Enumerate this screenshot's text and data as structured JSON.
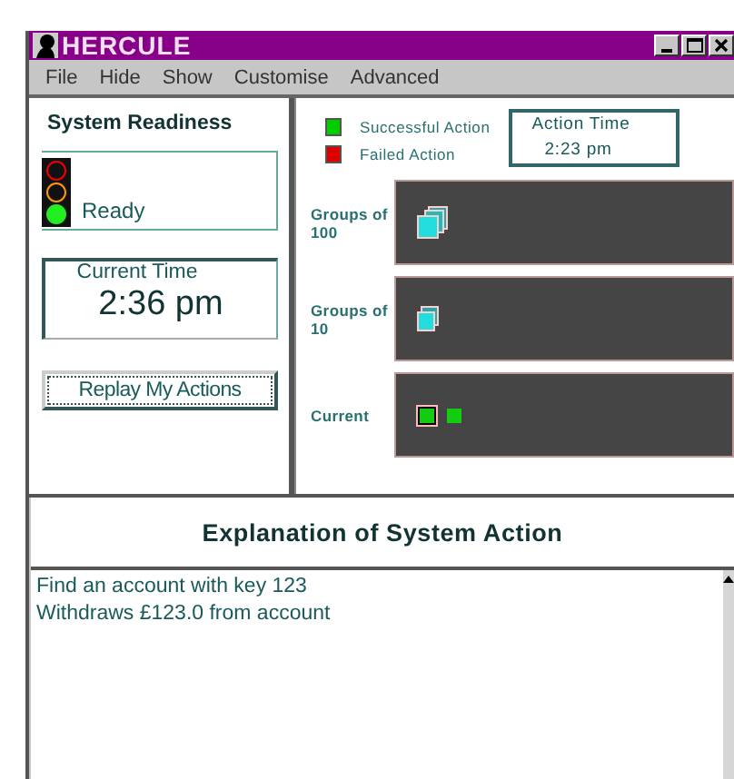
{
  "window": {
    "title": "HERCULE"
  },
  "menu": [
    "File",
    "Hide",
    "Show",
    "Customise",
    "Advanced"
  ],
  "readiness": {
    "title": "System Readiness",
    "lights": [
      {
        "color": "#ee0000",
        "on": false
      },
      {
        "color": "#ff9900",
        "on": false
      },
      {
        "color": "#22ee22",
        "on": true
      }
    ],
    "status": "Ready"
  },
  "current_time": {
    "label": "Current Time",
    "value": "2:36 pm"
  },
  "replay_button": "Replay My Actions",
  "legend": [
    {
      "label": "Successful Action",
      "color": "#00cc00"
    },
    {
      "label": "Failed Action",
      "color": "#dd0000"
    }
  ],
  "action_time": {
    "label": "Action Time",
    "value": "2:23 pm"
  },
  "tracks": [
    {
      "label": "Groups of 100",
      "items": [
        {
          "kind": "stack-large"
        }
      ]
    },
    {
      "label": "Groups of 10",
      "items": [
        {
          "kind": "stack-small"
        }
      ]
    },
    {
      "label": "Current",
      "items": [
        {
          "kind": "success",
          "selected": true
        },
        {
          "kind": "success",
          "selected": false
        }
      ]
    }
  ],
  "explanation": {
    "title": "Explanation of System Action",
    "lines": [
      "Find an account with key  123",
      "Withdraws  £123.0 from account"
    ]
  }
}
